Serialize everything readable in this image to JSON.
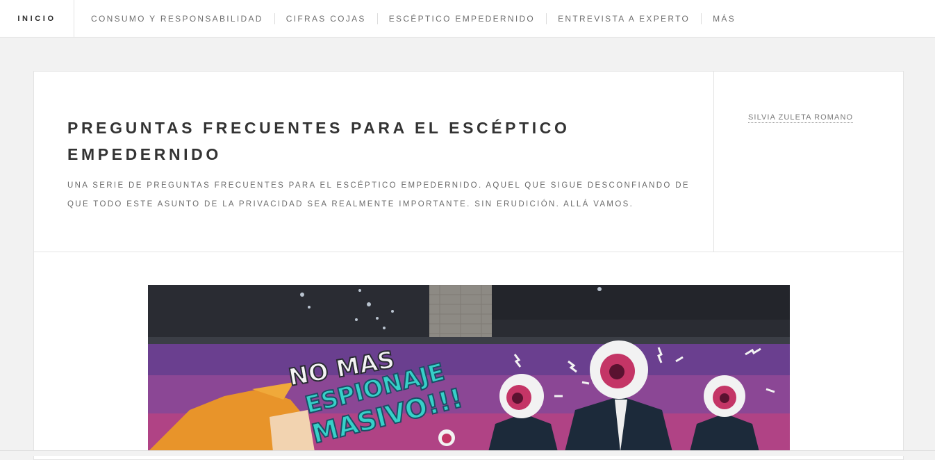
{
  "nav": {
    "home": "INICIO",
    "items": [
      "CONSUMO Y RESPONSABILIDAD",
      "CIFRAS COJAS",
      "ESCÉPTICO EMPEDERNIDO",
      "ENTREVISTA A EXPERTO",
      "MÁS"
    ]
  },
  "article": {
    "title": "PREGUNTAS FRECUENTES PARA EL ESCÉPTICO EMPEDERNIDO",
    "subtitle": "UNA SERIE DE PREGUNTAS FRECUENTES PARA EL ESCÉPTICO EMPEDERNIDO. AQUEL QUE SIGUE DESCONFIANDO DE QUE TODO ESTE ASUNTO DE LA PRIVACIDAD SEA REALMENTE IMPORTANTE. SIN ERUDICIÓN. ALLÁ VAMOS.",
    "author": "SILVIA ZULETA ROMANO"
  },
  "hero": {
    "graffiti_line1": "NO MAS",
    "graffiti_line2": "ESPIONAJE",
    "graffiti_line3": "MASIVO!!!"
  },
  "colors": {
    "accent_text": "#333333",
    "mural_purple": "#6a3f8f",
    "mural_pink": "#d0387a",
    "mural_teal": "#36d0c8"
  }
}
